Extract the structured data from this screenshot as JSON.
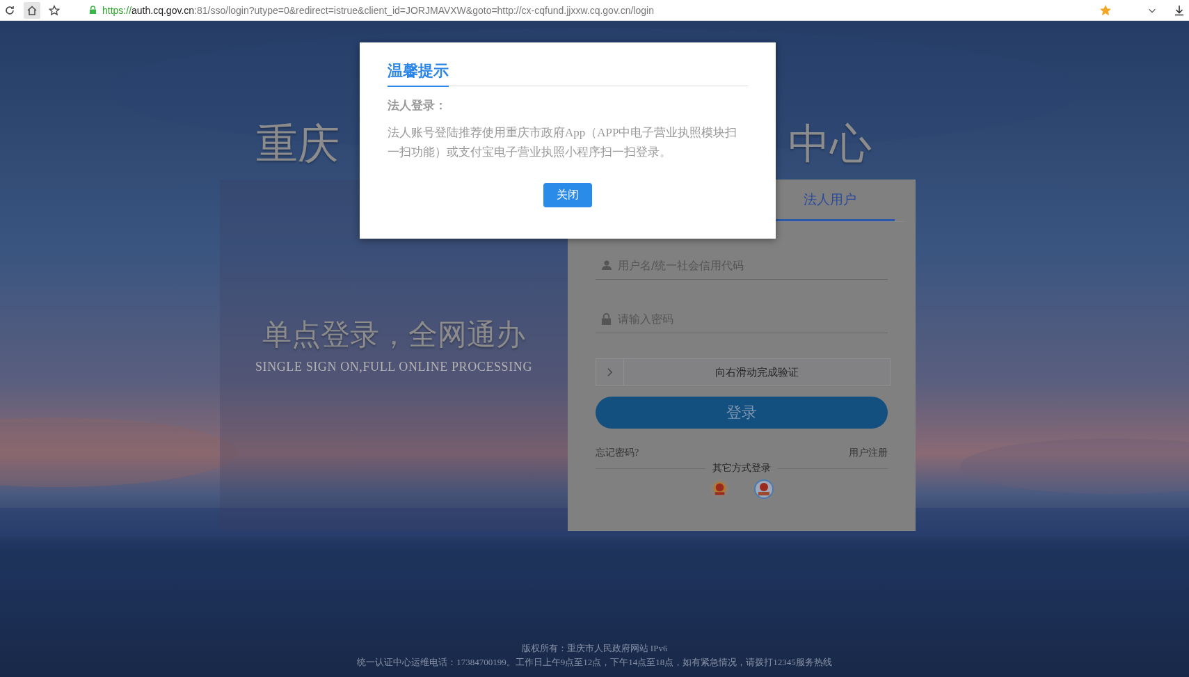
{
  "browser": {
    "url_scheme": "https://",
    "url_host": "auth.cq.gov.cn",
    "url_rest": ":81/sso/login?utype=0&redirect=istrue&client_id=JORJMAVXW&goto=http://cx-cqfund.jjxxw.cq.gov.cn/login",
    "bookmarked": true
  },
  "page": {
    "title_left": "重庆",
    "title_right": "中心",
    "slogan": "单点登录，全网通办",
    "slogan_en": "SINGLE SIGN ON,FULL ONLINE PROCESSING"
  },
  "login": {
    "tabs": [
      {
        "label": "法人用户",
        "selected": true
      }
    ],
    "username": {
      "placeholder": "用户名/统一社会信用代码"
    },
    "password": {
      "placeholder": "请输入密码"
    },
    "slider": {
      "label": "向右滑动完成验证"
    },
    "submit": "登录",
    "forgot": "忘记密码?",
    "register": "用户注册",
    "other_login": "其它方式登录"
  },
  "footer": [
    "版权所有：重庆市人民政府网站 IPv6",
    "统一认证中心运维电话：17384700199。工作日上午9点至12点，下午14点至18点，如有紧急情况，请拨打12345服务热线"
  ],
  "dialog": {
    "title": "温馨提示",
    "heading": "法人登录：",
    "body": "法人账号登陆推荐使用重庆市政府App（APP中电子营业执照模块扫一扫功能）或支付宝电子营业执照小程序扫一扫登录。",
    "button": "关闭"
  }
}
